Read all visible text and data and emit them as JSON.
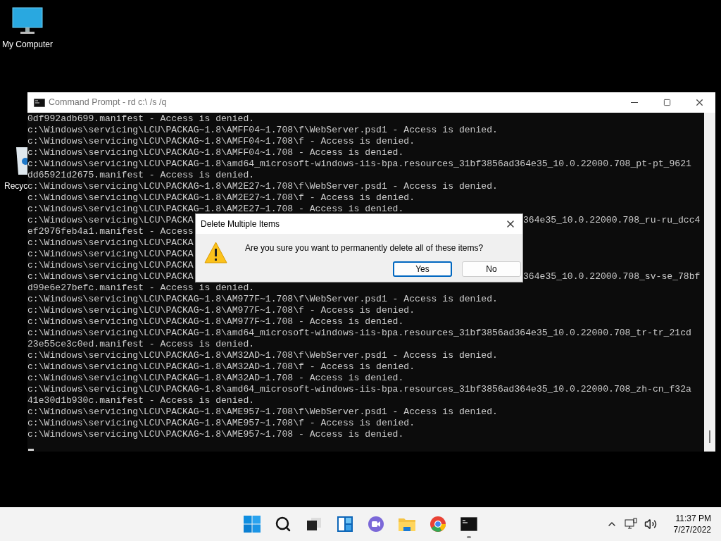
{
  "desktop_icons": [
    {
      "kind": "computer",
      "label": "My Computer"
    },
    {
      "kind": "recycle-bin",
      "label": "Recyc"
    }
  ],
  "window": {
    "title": "Command Prompt - rd  c:\\ /s /q",
    "lines": [
      {
        "text": "0df992adb699.manifest - Access is denied."
      },
      {
        "text": "c:\\Windows\\servicing\\LCU\\PACKAG~1.8\\AMFF04~1.708\\f\\WebServer.psd1 - Access is denied."
      },
      {
        "text": "c:\\Windows\\servicing\\LCU\\PACKAG~1.8\\AMFF04~1.708\\f - Access is denied."
      },
      {
        "text": "c:\\Windows\\servicing\\LCU\\PACKAG~1.8\\AMFF04~1.708 - Access is denied."
      },
      {
        "text": "c:\\Windows\\servicing\\LCU\\PACKAG~1.8\\amd64_microsoft-windows-iis-bpa.resources_31bf3856ad364e35_10.0.22000.708_pt-pt_9621"
      },
      {
        "text": "dd65921d2675.manifest - Access is denied."
      },
      {
        "text": "c:\\Windows\\servicing\\LCU\\PACKAG~1.8\\AM2E27~1.708\\f\\WebServer.psd1 - Access is denied."
      },
      {
        "text": "c:\\Windows\\servicing\\LCU\\PACKAG~1.8\\AM2E27~1.708\\f - Access is denied."
      },
      {
        "text": "c:\\Windows\\servicing\\LCU\\PACKAG~1.8\\AM2E27~1.708 - Access is denied."
      },
      {
        "text": "c:\\Windows\\servicing\\LCU\\PACKA",
        "right": "364e35_10.0.22000.708_ru-ru_dcc4"
      },
      {
        "text": "ef2976feb4a1.manifest - Access"
      },
      {
        "text": "c:\\Windows\\servicing\\LCU\\PACKA"
      },
      {
        "text": "c:\\Windows\\servicing\\LCU\\PACKA"
      },
      {
        "text": "c:\\Windows\\servicing\\LCU\\PACKA"
      },
      {
        "text": "c:\\Windows\\servicing\\LCU\\PACKA",
        "right": "364e35_10.0.22000.708_sv-se_78bf"
      },
      {
        "text": "d99e6e27befc.manifest - Access is denied."
      },
      {
        "text": "c:\\Windows\\servicing\\LCU\\PACKAG~1.8\\AM977F~1.708\\f\\WebServer.psd1 - Access is denied."
      },
      {
        "text": "c:\\Windows\\servicing\\LCU\\PACKAG~1.8\\AM977F~1.708\\f - Access is denied."
      },
      {
        "text": "c:\\Windows\\servicing\\LCU\\PACKAG~1.8\\AM977F~1.708 - Access is denied."
      },
      {
        "text": "c:\\Windows\\servicing\\LCU\\PACKAG~1.8\\amd64_microsoft-windows-iis-bpa.resources_31bf3856ad364e35_10.0.22000.708_tr-tr_21cd"
      },
      {
        "text": "23e55ce3c0ed.manifest - Access is denied."
      },
      {
        "text": "c:\\Windows\\servicing\\LCU\\PACKAG~1.8\\AM32AD~1.708\\f\\WebServer.psd1 - Access is denied."
      },
      {
        "text": "c:\\Windows\\servicing\\LCU\\PACKAG~1.8\\AM32AD~1.708\\f - Access is denied."
      },
      {
        "text": "c:\\Windows\\servicing\\LCU\\PACKAG~1.8\\AM32AD~1.708 - Access is denied."
      },
      {
        "text": "c:\\Windows\\servicing\\LCU\\PACKAG~1.8\\amd64_microsoft-windows-iis-bpa.resources_31bf3856ad364e35_10.0.22000.708_zh-cn_f32a"
      },
      {
        "text": "41e30d1b930c.manifest - Access is denied."
      },
      {
        "text": "c:\\Windows\\servicing\\LCU\\PACKAG~1.8\\AME957~1.708\\f\\WebServer.psd1 - Access is denied."
      },
      {
        "text": "c:\\Windows\\servicing\\LCU\\PACKAG~1.8\\AME957~1.708\\f - Access is denied."
      },
      {
        "text": "c:\\Windows\\servicing\\LCU\\PACKAG~1.8\\AME957~1.708 - Access is denied."
      }
    ]
  },
  "dialog": {
    "title": "Delete Multiple Items",
    "message": "Are you sure you want to permanently delete all of these items?",
    "buttons": [
      {
        "label": "Yes",
        "selected": true
      },
      {
        "label": "No",
        "selected": false
      }
    ]
  },
  "taskbar": {
    "apps": [
      {
        "kind": "start",
        "running": false
      },
      {
        "kind": "search",
        "running": false
      },
      {
        "kind": "task-view",
        "running": false
      },
      {
        "kind": "widgets",
        "running": false
      },
      {
        "kind": "chat",
        "running": false
      },
      {
        "kind": "explorer",
        "running": false
      },
      {
        "kind": "chrome",
        "running": false
      },
      {
        "kind": "terminal",
        "running": true
      }
    ],
    "time": "11:37 PM",
    "date": "7/27/2022"
  }
}
